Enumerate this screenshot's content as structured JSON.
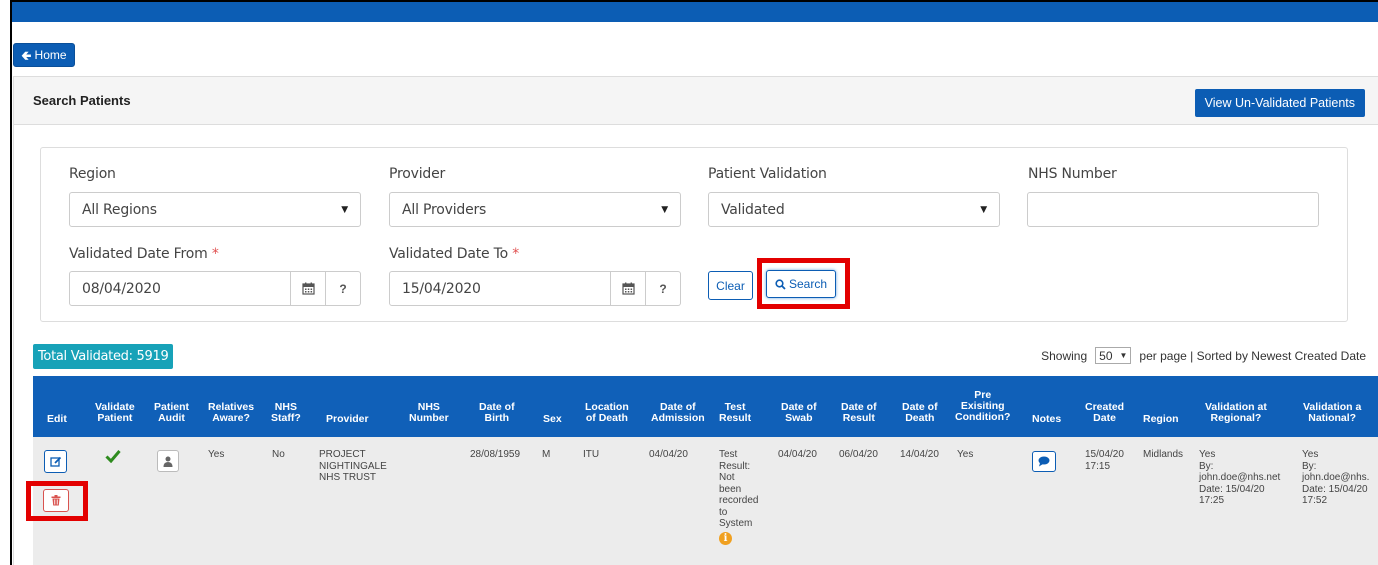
{
  "nav": {
    "home_label": "Home"
  },
  "panel": {
    "title": "Search Patients",
    "unvalidated_button": "View Un-Validated Patients"
  },
  "filters": {
    "region_label": "Region",
    "region_value": "All Regions",
    "provider_label": "Provider",
    "provider_value": "All Providers",
    "validation_label": "Patient Validation",
    "validation_value": "Validated",
    "nhs_label": "NHS Number",
    "nhs_value": "",
    "date_from_label": "Validated Date From",
    "date_from_value": "08/04/2020",
    "date_to_label": "Validated Date To",
    "date_to_value": "15/04/2020",
    "required_mark": "*",
    "help_label": "?",
    "clear_label": "Clear",
    "search_label": "Search"
  },
  "summary": {
    "total_label": "Total Validated: 5919",
    "showing_label": "Showing",
    "per_page_value": "50",
    "sort_text": "per page | Sorted by Newest Created Date"
  },
  "table": {
    "headers": {
      "edit": "Edit",
      "validate_1": "Validate",
      "validate_2": "Patient",
      "audit_1": "Patient",
      "audit_2": "Audit",
      "relatives_1": "Relatives",
      "relatives_2": "Aware?",
      "nhsstaff_1": "NHS",
      "nhsstaff_2": "Staff?",
      "provider": "Provider",
      "nhsnum_1": "NHS",
      "nhsnum_2": "Number",
      "dob_1": "Date of",
      "dob_2": "Birth",
      "sex": "Sex",
      "lod_1": "Location",
      "lod_2": "of Death",
      "doa_1": "Date of",
      "doa_2": "Admission",
      "test_1": "Test",
      "test_2": "Result",
      "swab_1": "Date of",
      "swab_2": "Swab",
      "dor_1": "Date of",
      "dor_2": "Result",
      "dod_1": "Date of",
      "dod_2": "Death",
      "pre_1": "Pre",
      "pre_2": "Exisiting",
      "pre_3": "Condition?",
      "notes": "Notes",
      "created_1": "Created",
      "created_2": "Date",
      "region": "Region",
      "valreg_1": "Validation at",
      "valreg_2": "Regional?",
      "valnat_1": "Validation a",
      "valnat_2": "National?"
    },
    "row": {
      "relatives_aware": "Yes",
      "nhs_staff": "No",
      "provider_1": "PROJECT",
      "provider_2": "NIGHTINGALE",
      "provider_3": "NHS TRUST",
      "nhs_number": "",
      "dob": "28/08/1959",
      "sex": "M",
      "location_of_death": "ITU",
      "date_of_admission": "04/04/20",
      "test_result_lines": [
        "Test",
        "Result:",
        "Not",
        "been",
        "recorded",
        "to",
        "System"
      ],
      "date_of_swab": "04/04/20",
      "date_of_result": "06/04/20",
      "date_of_death": "14/04/20",
      "pre_existing": "Yes",
      "created_1": "15/04/20",
      "created_2": "17:15",
      "region": "Midlands",
      "val_regional": [
        "Yes",
        "By:",
        "john.doe@nhs.net",
        "Date: 15/04/20",
        "17:25"
      ],
      "val_national": [
        "Yes",
        "By:",
        "john.doe@nhs.",
        "Date: 15/04/20",
        "17:52"
      ]
    }
  },
  "colors": {
    "primary": "#0c5db4",
    "header_bg": "#1060b8",
    "badge": "#17a2b8",
    "highlight": "#e30000",
    "check": "#2e8b1e",
    "delete": "#d9534f",
    "info": "#f0a020"
  }
}
